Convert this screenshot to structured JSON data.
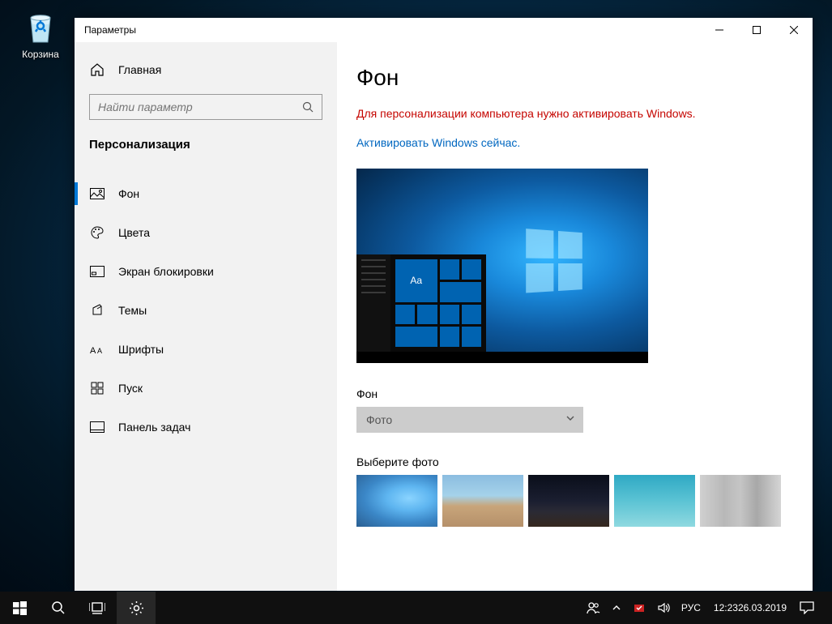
{
  "desktop": {
    "recycle_bin": "Корзина"
  },
  "window": {
    "title": "Параметры"
  },
  "sidebar": {
    "home": "Главная",
    "search_placeholder": "Найти параметр",
    "category": "Персонализация",
    "items": [
      {
        "label": "Фон"
      },
      {
        "label": "Цвета"
      },
      {
        "label": "Экран блокировки"
      },
      {
        "label": "Темы"
      },
      {
        "label": "Шрифты"
      },
      {
        "label": "Пуск"
      },
      {
        "label": "Панель задач"
      }
    ]
  },
  "content": {
    "title": "Фон",
    "warning": "Для персонализации компьютера нужно активировать Windows.",
    "activate_link": "Активировать Windows сейчас.",
    "preview_sample": "Aa",
    "bg_label": "Фон",
    "bg_select": "Фото",
    "choose_label": "Выберите фото"
  },
  "taskbar": {
    "lang": "РУС",
    "time": "12:23",
    "date": "26.03.2019"
  }
}
